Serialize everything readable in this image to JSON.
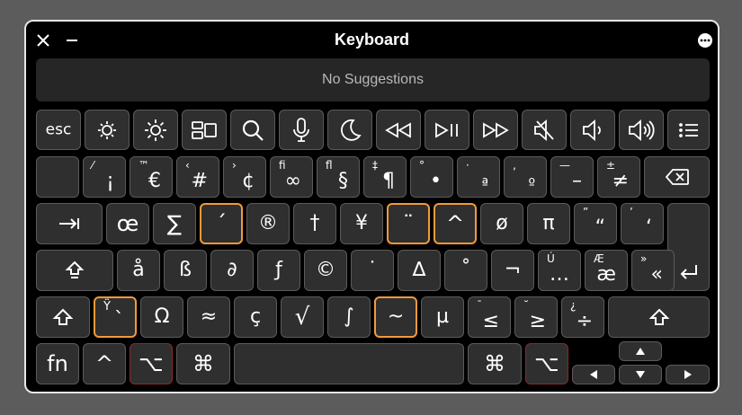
{
  "window": {
    "title": "Keyboard",
    "suggestions": "No Suggestions"
  },
  "fn_row": {
    "esc": "esc"
  },
  "number_row": [
    {
      "sub": "⁄",
      "main": "¡"
    },
    {
      "sub": "™",
      "main": "€"
    },
    {
      "sub": "‹",
      "main": "#"
    },
    {
      "sub": "›",
      "main": "¢"
    },
    {
      "sub": "ﬁ",
      "main": "∞"
    },
    {
      "sub": "ﬂ",
      "main": "§"
    },
    {
      "sub": "‡",
      "main": "¶"
    },
    {
      "sub": "°",
      "main": "•"
    },
    {
      "sub": "·",
      "main": "ª"
    },
    {
      "sub": "‚",
      "main": "º"
    },
    {
      "sub": "—",
      "main": "–"
    },
    {
      "sub": "±",
      "main": "≠"
    }
  ],
  "qwerty_row": [
    "œ",
    "∑",
    "´",
    "®",
    "†",
    "¥",
    "¨",
    "^",
    "ø",
    "π"
  ],
  "qwerty_row_dual": [
    {
      "sub": "”",
      "main": "“"
    },
    {
      "sub": "’",
      "main": "‘"
    }
  ],
  "home_row": [
    "å",
    "ß",
    "∂",
    "ƒ",
    "©",
    "˙",
    "∆",
    "˚",
    "¬"
  ],
  "home_row_dual": [
    {
      "sub": "Ú",
      "main": "…"
    },
    {
      "sub": "Æ",
      "main": "æ"
    },
    {
      "sub": "»",
      "main": "«"
    }
  ],
  "bottom_letter_row": {
    "dead_key": {
      "sub": "Ÿ",
      "main": "`"
    },
    "keys": [
      "Ω",
      "≈",
      "ç",
      "√",
      "∫",
      "~",
      "µ"
    ],
    "dual": [
      {
        "sub": "¯",
        "main": "≤"
      },
      {
        "sub": "˘",
        "main": "≥"
      },
      {
        "sub": "¿",
        "main": "÷"
      }
    ]
  },
  "modifier_row": {
    "fn": "fn",
    "ctrl": "^",
    "option": "⌥",
    "command": "⌘"
  },
  "colors": {
    "accent_orange": "#f39a3a",
    "option_red": "#8a2a2a",
    "key_bg": "#2f2f2f",
    "window_bg": "#000000"
  }
}
